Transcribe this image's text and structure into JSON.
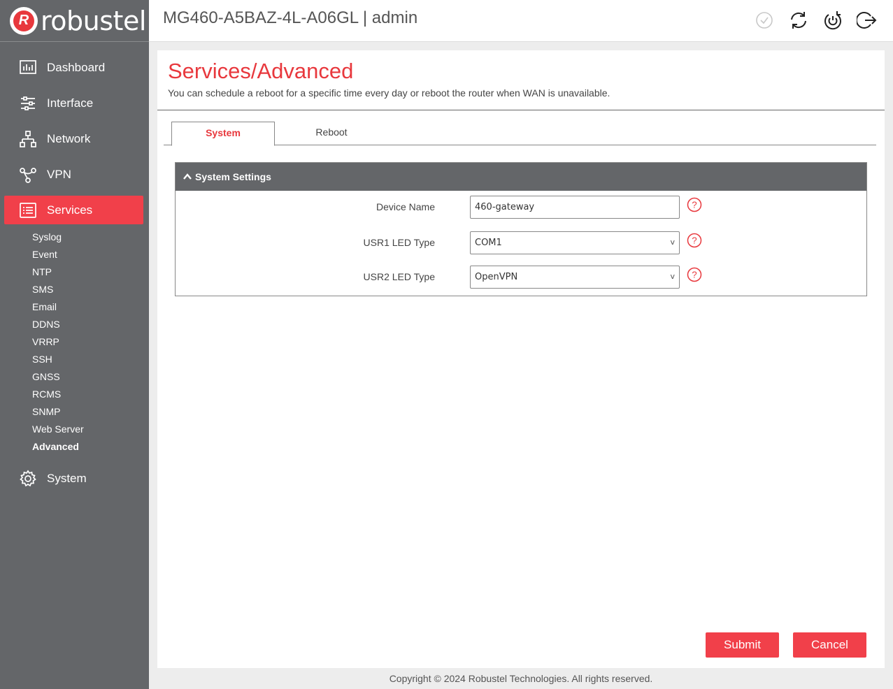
{
  "brand": {
    "name": "robustel",
    "badge_letter": "R",
    "accent": "#e8383d",
    "sidebar_bg": "#646669",
    "active_bg": "#f1404a"
  },
  "header": {
    "title": "MG460-A5BAZ-4L-A06GL | admin",
    "icons": [
      "apply-check-icon",
      "refresh-icon",
      "reboot-icon",
      "logout-icon"
    ]
  },
  "sidebar": {
    "items": [
      {
        "label": "Dashboard",
        "icon": "dashboard-icon"
      },
      {
        "label": "Interface",
        "icon": "sliders-icon"
      },
      {
        "label": "Network",
        "icon": "network-icon"
      },
      {
        "label": "VPN",
        "icon": "vpn-icon"
      },
      {
        "label": "Services",
        "icon": "services-icon",
        "active": true
      },
      {
        "label": "System",
        "icon": "gear-icon"
      }
    ],
    "services_sub": [
      "Syslog",
      "Event",
      "NTP",
      "SMS",
      "Email",
      "DDNS",
      "VRRP",
      "SSH",
      "GNSS",
      "RCMS",
      "SNMP",
      "Web Server",
      "Advanced"
    ],
    "current_sub": "Advanced"
  },
  "page": {
    "title": "Services/Advanced",
    "description": "You can schedule a reboot for a specific time every day or reboot the router when WAN is unavailable."
  },
  "tabs": [
    {
      "label": "System",
      "active": true
    },
    {
      "label": "Reboot",
      "active": false
    }
  ],
  "panel": {
    "title": "System Settings",
    "fields": [
      {
        "label": "Device Name",
        "type": "text",
        "value": "460-gateway"
      },
      {
        "label": "USR1 LED Type",
        "type": "select",
        "value": "COM1"
      },
      {
        "label": "USR2 LED Type",
        "type": "select",
        "value": "OpenVPN"
      }
    ]
  },
  "buttons": {
    "submit": "Submit",
    "cancel": "Cancel"
  },
  "footer": {
    "copyright": "Copyright © 2024 Robustel Technologies. All rights reserved."
  }
}
